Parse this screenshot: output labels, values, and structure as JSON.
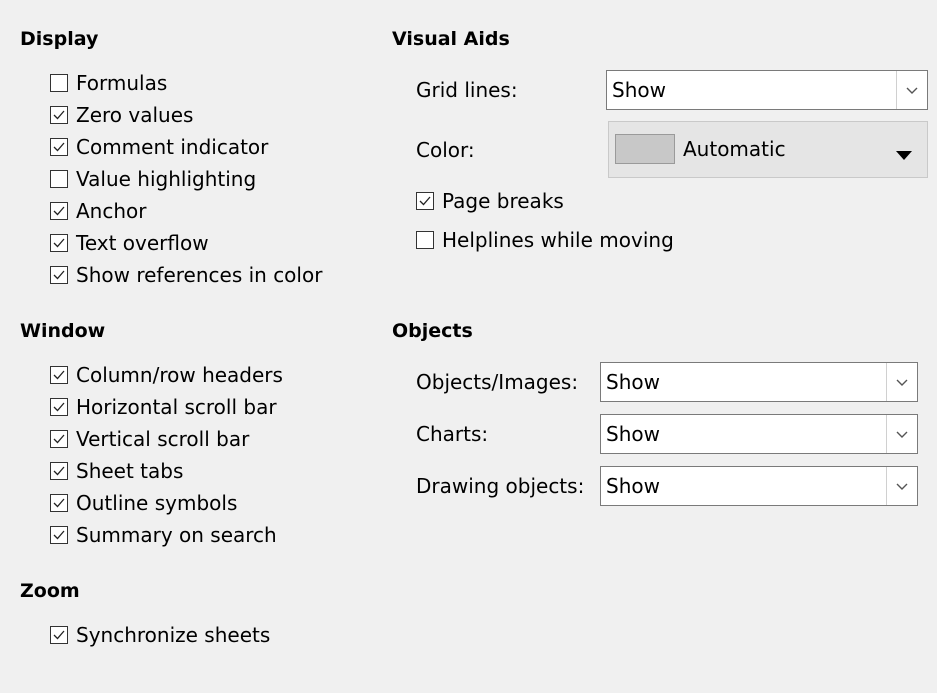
{
  "display": {
    "title": "Display",
    "items": [
      {
        "label": "Formulas",
        "checked": false
      },
      {
        "label": "Zero values",
        "checked": true
      },
      {
        "label": "Comment indicator",
        "checked": true
      },
      {
        "label": "Value highlighting",
        "checked": false
      },
      {
        "label": "Anchor",
        "checked": true
      },
      {
        "label": "Text overflow",
        "checked": true
      },
      {
        "label": "Show references in color",
        "checked": true
      }
    ]
  },
  "window": {
    "title": "Window",
    "items": [
      {
        "label": "Column/row headers",
        "checked": true
      },
      {
        "label": "Horizontal scroll bar",
        "checked": true
      },
      {
        "label": "Vertical scroll bar",
        "checked": true
      },
      {
        "label": "Sheet tabs",
        "checked": true
      },
      {
        "label": "Outline symbols",
        "checked": true
      },
      {
        "label": "Summary on search",
        "checked": true
      }
    ]
  },
  "zoom": {
    "title": "Zoom",
    "items": [
      {
        "label": "Synchronize sheets",
        "checked": true
      }
    ]
  },
  "visual_aids": {
    "title": "Visual Aids",
    "grid_lines_label": "Grid lines:",
    "grid_lines_value": "Show",
    "color_label": "Color:",
    "color_value": "Automatic",
    "color_swatch": "#c8c8c8",
    "items": [
      {
        "label": "Page breaks",
        "checked": true
      },
      {
        "label": "Helplines while moving",
        "checked": false
      }
    ]
  },
  "objects": {
    "title": "Objects",
    "rows": [
      {
        "label": "Objects/Images:",
        "value": "Show"
      },
      {
        "label": "Charts:",
        "value": "Show"
      },
      {
        "label": "Drawing objects:",
        "value": "Show"
      }
    ]
  },
  "icons": {
    "checkmark": "checkmark-icon",
    "dropdown": "chevron-down-icon",
    "color_dropdown": "triangle-down-icon"
  }
}
